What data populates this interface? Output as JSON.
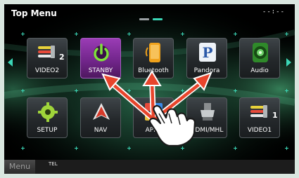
{
  "header": {
    "title": "Top Menu",
    "clock": "--:--"
  },
  "colors": {
    "accent": "#3bd6b6",
    "gesture_arrow": "#e8452c",
    "stanby_tile": "#8a2fa8"
  },
  "tiles": [
    {
      "label": "VIDEO2",
      "icon": "av-cable-icon",
      "badge": "2"
    },
    {
      "label": "STANBY",
      "icon": "power-icon"
    },
    {
      "label": "Bluetooth",
      "icon": "phone-icon"
    },
    {
      "label": "Pandora",
      "icon": "pandora-icon"
    },
    {
      "label": "Audio",
      "icon": "speaker-icon"
    },
    {
      "label": "SETUP",
      "icon": "gear-icon"
    },
    {
      "label": "NAV",
      "icon": "navigation-icon"
    },
    {
      "label": "APPS",
      "icon": "apps-icon"
    },
    {
      "label": "HDMI/MHL",
      "icon": "hdmi-icon"
    },
    {
      "label": "VIDEO1",
      "icon": "av-cable-icon",
      "badge": "1"
    }
  ],
  "bottom_bar": {
    "menu_label": "Menu",
    "tel_label": "TEL"
  }
}
